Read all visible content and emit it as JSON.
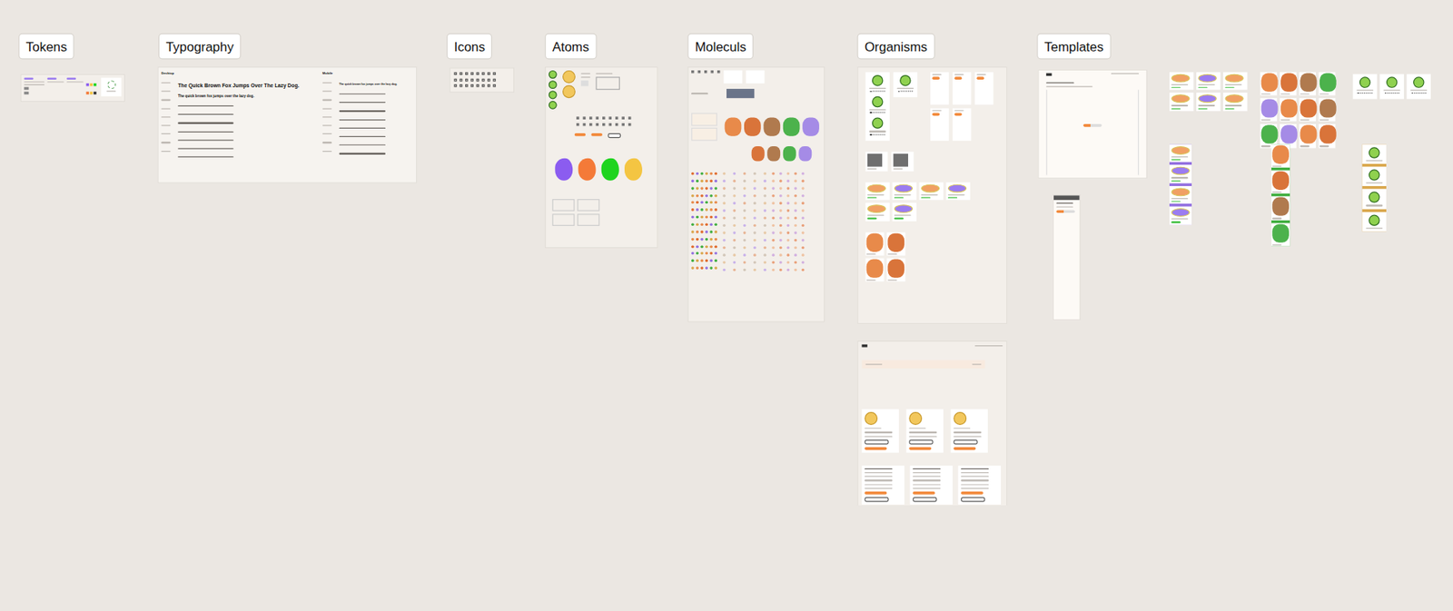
{
  "sections": [
    {
      "label": "Tokens"
    },
    {
      "label": "Typography"
    },
    {
      "label": "Icons"
    },
    {
      "label": "Atoms"
    },
    {
      "label": "Moleculs"
    },
    {
      "label": "Organisms"
    },
    {
      "label": "Templates"
    }
  ],
  "typography": {
    "desktop": {
      "label": "Desktop",
      "headline": "The Quick Brown Fox Jumps Over The Lazy Dog.",
      "subhead": "The quick brown fox jumps over the lazy dog."
    },
    "mobile": {
      "label": "Mobile",
      "headline": "The quick brown fox jumps over the lazy dog."
    }
  },
  "atoms": {
    "blobs": [
      {
        "color": "#8b5cf0"
      },
      {
        "color": "#f47a38"
      },
      {
        "color": "#1fd41f"
      },
      {
        "color": "#f4c542"
      }
    ]
  }
}
